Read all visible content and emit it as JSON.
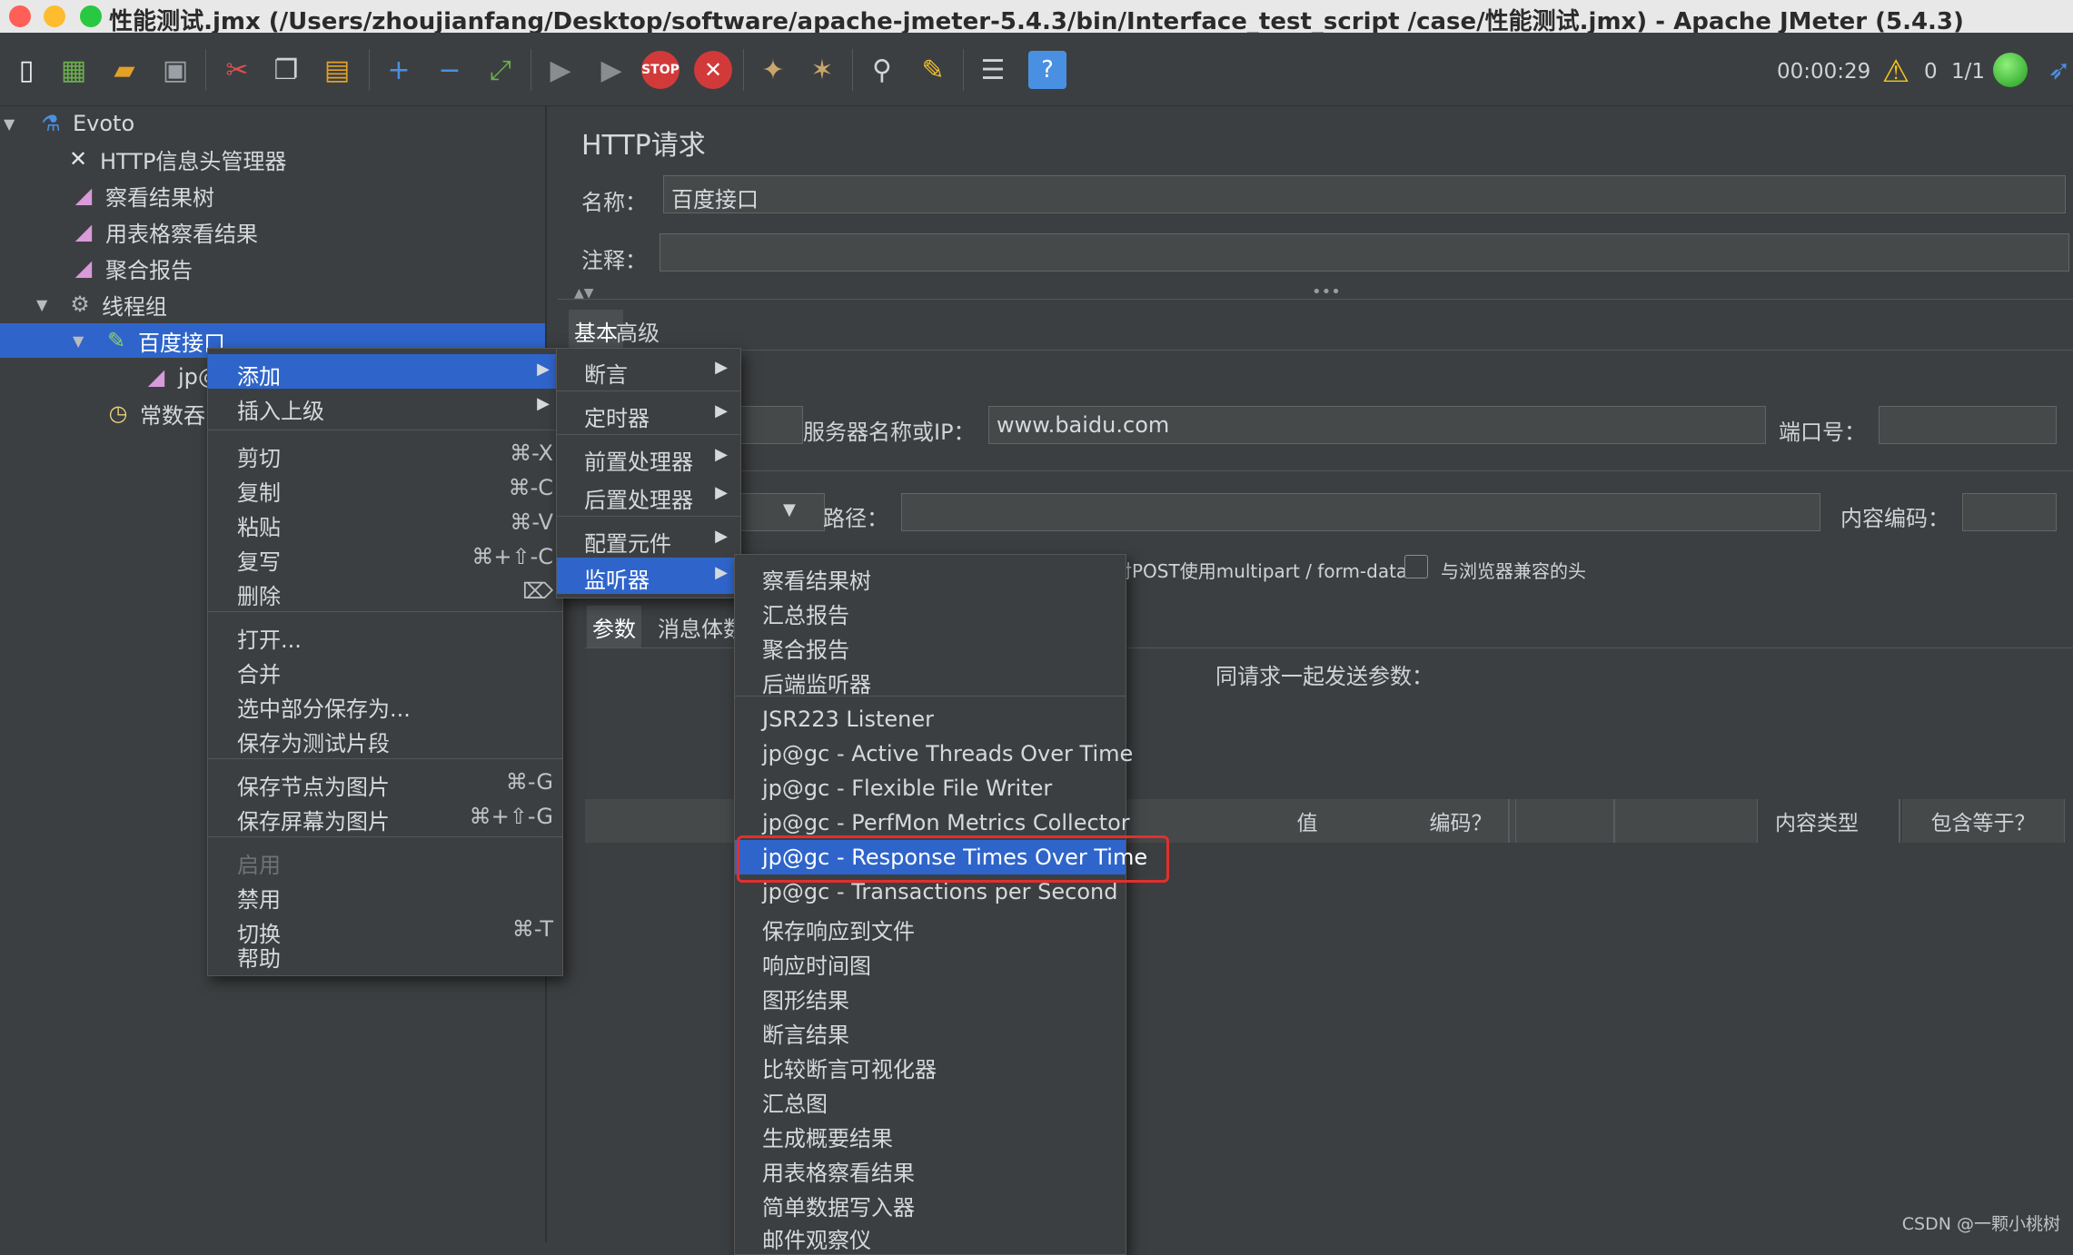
{
  "window": {
    "title": "性能测试.jmx (/Users/zhoujianfang/Desktop/software/apache-jmeter-5.4.3/bin/Interface_test_script  /case/性能测试.jmx) - Apache JMeter (5.4.3)"
  },
  "toolbar": {
    "elapsed_time": "00:00:29",
    "warning_count": "0",
    "threads": "1/1",
    "icons": [
      "new-icon",
      "templates-icon",
      "open-icon",
      "save-icon",
      "cut-icon",
      "copy-icon",
      "paste-icon",
      "expand-icon",
      "collapse-icon",
      "toggle-icon",
      "start-icon",
      "start-no-pause-icon",
      "stop-icon",
      "shutdown-icon",
      "clear-icon",
      "clear-all-icon",
      "search-icon",
      "reset-search-icon",
      "function-helper-icon",
      "help-icon"
    ]
  },
  "tree": {
    "nodes": [
      {
        "label": "Evoto",
        "icon": "flask-icon"
      },
      {
        "label": "HTTP信息头管理器",
        "icon": "tools-icon"
      },
      {
        "label": "察看结果树",
        "icon": "chart-icon"
      },
      {
        "label": "用表格察看结果",
        "icon": "chart-icon"
      },
      {
        "label": "聚合报告",
        "icon": "chart-icon"
      },
      {
        "label": "线程组",
        "icon": "gear-icon"
      },
      {
        "label": "百度接口",
        "icon": "pipette-icon"
      },
      {
        "label": "jp@",
        "icon": "chart-icon"
      },
      {
        "label": "常数吞",
        "icon": "timer-icon"
      }
    ]
  },
  "panel": {
    "title": "HTTP请求",
    "name_label": "名称：",
    "name_value": "百度接口",
    "comment_label": "注释：",
    "tabs": [
      "基本",
      "高级"
    ],
    "server_label": "服务器名称或IP：",
    "server_value": "www.baidu.com",
    "port_label": "端口号：",
    "path_label": "路径：",
    "encoding_label": "内容编码：",
    "multipart_label": "对POST使用multipart / form-data",
    "browser_headers_label": "与浏览器兼容的头",
    "sub_tabs": [
      "参数",
      "消息体数"
    ],
    "params_caption": "同请求一起发送参数：",
    "columns": [
      "值",
      "编码？",
      "内容类型",
      "包含等于？"
    ]
  },
  "context_menu": {
    "items": [
      {
        "label": "添加",
        "shortcut": "",
        "submenu": true
      },
      {
        "label": "插入上级",
        "shortcut": "",
        "submenu": true
      },
      {
        "label": "剪切",
        "shortcut": "⌘-X"
      },
      {
        "label": "复制",
        "shortcut": "⌘-C"
      },
      {
        "label": "粘贴",
        "shortcut": "⌘-V"
      },
      {
        "label": "复写",
        "shortcut": "⌘+⇧-C"
      },
      {
        "label": "删除",
        "shortcut": "⌦"
      },
      {
        "label": "打开...",
        "shortcut": ""
      },
      {
        "label": "合并",
        "shortcut": ""
      },
      {
        "label": "选中部分保存为...",
        "shortcut": ""
      },
      {
        "label": "保存为测试片段",
        "shortcut": ""
      },
      {
        "label": "保存节点为图片",
        "shortcut": "⌘-G"
      },
      {
        "label": "保存屏幕为图片",
        "shortcut": "⌘+⇧-G"
      },
      {
        "label": "启用",
        "shortcut": ""
      },
      {
        "label": "禁用",
        "shortcut": ""
      },
      {
        "label": "切换",
        "shortcut": "⌘-T"
      },
      {
        "label": "帮助",
        "shortcut": ""
      }
    ]
  },
  "add_submenu": {
    "items": [
      "断言",
      "定时器",
      "前置处理器",
      "后置处理器",
      "配置元件",
      "监听器"
    ]
  },
  "listener_submenu": {
    "items": [
      "察看结果树",
      "汇总报告",
      "聚合报告",
      "后端监听器",
      "JSR223 Listener",
      "jp@gc - Active Threads Over Time",
      "jp@gc - Flexible File Writer",
      "jp@gc - PerfMon Metrics Collector",
      "jp@gc - Response Times Over Time",
      "jp@gc - Transactions per Second",
      "保存响应到文件",
      "响应时间图",
      "图形结果",
      "断言结果",
      "比较断言可视化器",
      "汇总图",
      "生成概要结果",
      "用表格察看结果",
      "简单数据写入器",
      "邮件观察仪"
    ]
  },
  "watermark": "CSDN @一颗小桃树"
}
